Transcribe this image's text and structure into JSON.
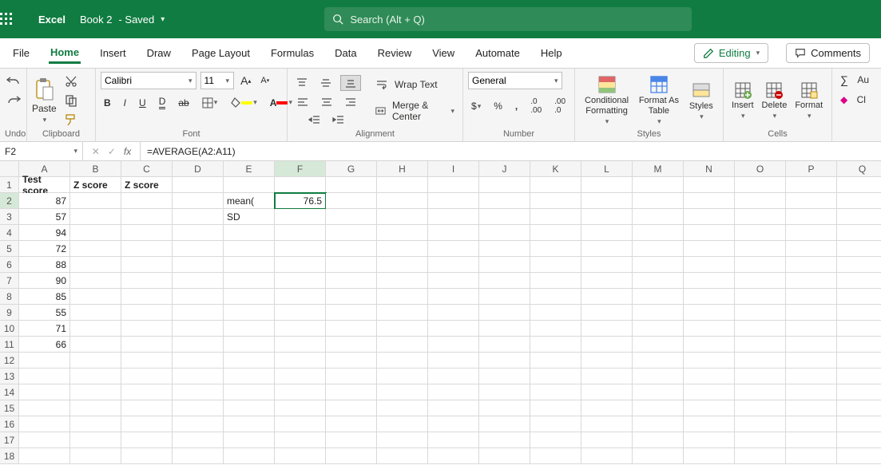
{
  "titlebar": {
    "app": "Excel",
    "doc": "Book 2",
    "status": "- Saved",
    "search_placeholder": "Search (Alt + Q)"
  },
  "tabs": {
    "items": [
      "File",
      "Home",
      "Insert",
      "Draw",
      "Page Layout",
      "Formulas",
      "Data",
      "Review",
      "View",
      "Automate",
      "Help"
    ],
    "active": "Home",
    "editing": "Editing",
    "comments": "Comments"
  },
  "ribbon": {
    "undo": "Undo",
    "clipboard": {
      "paste": "Paste",
      "label": "Clipboard"
    },
    "font": {
      "name": "Calibri",
      "size": "11",
      "label": "Font"
    },
    "alignment": {
      "wrap": "Wrap Text",
      "merge": "Merge & Center",
      "label": "Alignment"
    },
    "number": {
      "format": "General",
      "label": "Number"
    },
    "styles": {
      "cond": "Conditional Formatting",
      "table": "Format As Table",
      "styles": "Styles",
      "label": "Styles"
    },
    "cells": {
      "insert": "Insert",
      "delete": "Delete",
      "format": "Format",
      "label": "Cells"
    },
    "editing_group": {
      "autosum": "Au",
      "clear": "Cl"
    }
  },
  "formula_bar": {
    "cell": "F2",
    "formula": "=AVERAGE(A2:A11)"
  },
  "chart_data": {
    "type": "table",
    "columns": [
      "A",
      "B",
      "C",
      "D",
      "E",
      "F",
      "G",
      "H",
      "I",
      "J",
      "K",
      "L",
      "M",
      "N",
      "O",
      "P",
      "Q"
    ],
    "row_count": 18,
    "selected_cell": "F2",
    "cells": {
      "A1": "Test score",
      "B1": "Z score",
      "C1": "Z score",
      "A2": "87",
      "A3": "57",
      "A4": "94",
      "A5": "72",
      "A6": "88",
      "A7": "90",
      "A8": "85",
      "A9": "55",
      "A10": "71",
      "A11": "66",
      "E2": "mean(",
      "E3": "SD",
      "F2": "76.5"
    }
  }
}
